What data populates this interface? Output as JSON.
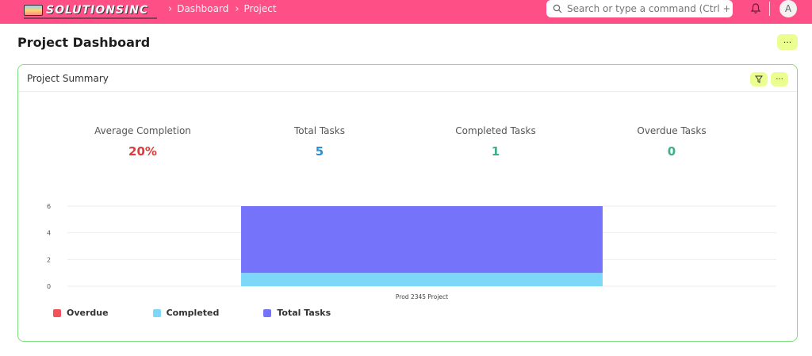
{
  "navbar": {
    "logo_text": "SOLUTIONSINC",
    "breadcrumbs": [
      "Dashboard",
      "Project"
    ],
    "search_placeholder": "Search or type a command (Ctrl + G",
    "avatar_initial": "A",
    "bg_color": "#ff4f87"
  },
  "page": {
    "title": "Project Dashboard",
    "menu_label": "···"
  },
  "card": {
    "title": "Project Summary",
    "filter_icon": "filter-icon",
    "menu_label": "···",
    "stats": [
      {
        "label": "Average Completion",
        "value": "20%",
        "color": "#e03b3b"
      },
      {
        "label": "Total Tasks",
        "value": "5",
        "color": "#2b8fd6"
      },
      {
        "label": "Completed Tasks",
        "value": "1",
        "color": "#3bb08a"
      },
      {
        "label": "Overdue Tasks",
        "value": "0",
        "color": "#3bb08a"
      }
    ]
  },
  "chart_data": {
    "type": "bar",
    "stacked": true,
    "categories": [
      "Prod 2345 Project"
    ],
    "series": [
      {
        "name": "Overdue",
        "values": [
          0
        ],
        "color": "#f2525a"
      },
      {
        "name": "Completed",
        "values": [
          1
        ],
        "color": "#7dd8f8"
      },
      {
        "name": "Total Tasks",
        "values": [
          5
        ],
        "color": "#7673fb"
      }
    ],
    "ylim": [
      0,
      6
    ],
    "yticks": [
      0,
      2,
      4,
      6
    ],
    "grid": true,
    "legend": "bottom-left"
  }
}
